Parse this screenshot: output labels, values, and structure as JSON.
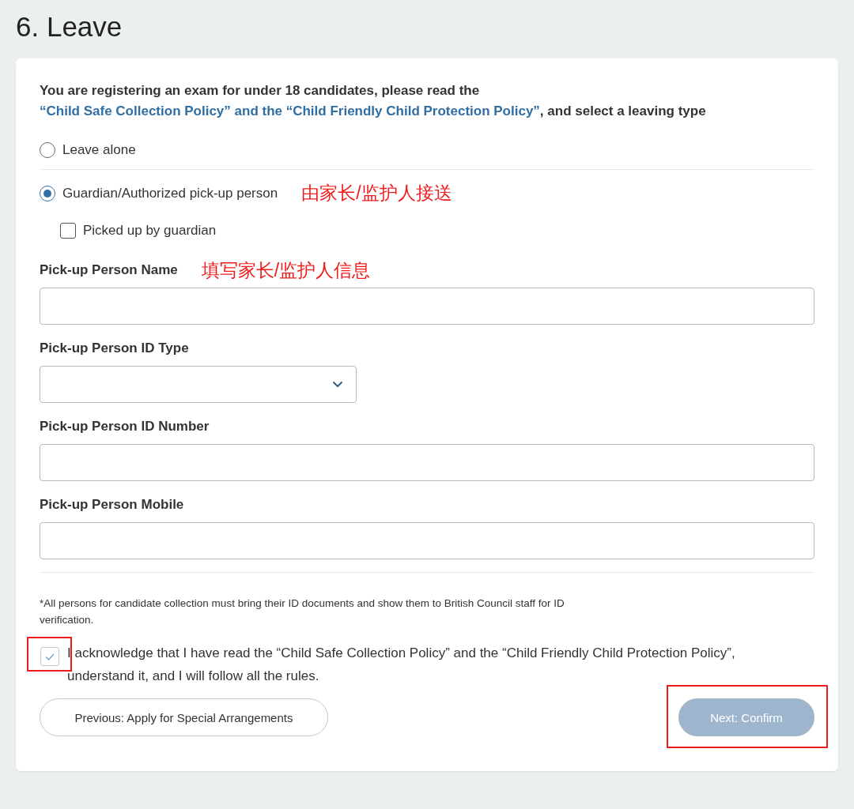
{
  "page_title": "6. Leave",
  "intro": {
    "before": "You are registering an exam for under 18 candidates, please read the ",
    "link": "“Child Safe Collection Policy” and the “Child Friendly Child Protection Policy”",
    "after": ", and select a leaving type"
  },
  "leave_types": [
    {
      "label": "Leave alone",
      "selected": false
    },
    {
      "label": "Guardian/Authorized pick-up person",
      "selected": true,
      "annotation": "由家长/监护人接送"
    }
  ],
  "guardian_pickup": {
    "label": "Picked up by guardian",
    "checked": false
  },
  "fields": [
    {
      "kind": "text",
      "label": "Pick-up Person Name",
      "annotation": "填写家长/监护人信息"
    },
    {
      "kind": "select",
      "label": "Pick-up Person ID Type"
    },
    {
      "kind": "text",
      "label": "Pick-up Person ID Number"
    },
    {
      "kind": "text",
      "label": "Pick-up Person Mobile"
    }
  ],
  "note": "*All persons for candidate collection must bring their ID documents and show them to British Council staff for ID verification.",
  "acknowledge": {
    "label": "I acknowledge that I have read the “Child Safe Collection Policy” and the “Child Friendly Child Protection Policy”, understand it, and I will follow all the rules.",
    "checked": true,
    "highlighted": true
  },
  "buttons": [
    {
      "kind": "secondary",
      "label": "Previous: Apply for Special Arrangements",
      "disabled": false,
      "highlighted": false
    },
    {
      "kind": "primary",
      "label": "Next: Confirm",
      "disabled": true,
      "highlighted": true
    }
  ]
}
